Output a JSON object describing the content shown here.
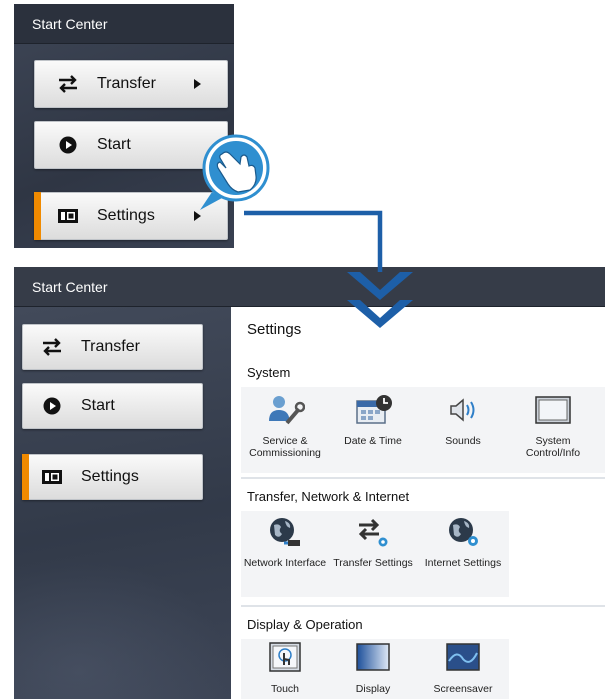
{
  "app_title": "Start Center",
  "top_menu": {
    "items": [
      {
        "label": "Transfer",
        "icon": "transfer-icon",
        "has_arrow": true
      },
      {
        "label": "Start",
        "icon": "play-icon",
        "has_arrow": false
      },
      {
        "label": "Settings",
        "icon": "settings-icon",
        "has_arrow": true,
        "active": true
      }
    ]
  },
  "sidebar": {
    "items": [
      {
        "label": "Transfer",
        "icon": "transfer-icon"
      },
      {
        "label": "Start",
        "icon": "play-icon"
      },
      {
        "label": "Settings",
        "icon": "settings-icon",
        "active": true
      }
    ]
  },
  "settings": {
    "title": "Settings",
    "sections": [
      {
        "title": "System",
        "items": [
          {
            "label": "Service & Commissioning",
            "icon": "service-commissioning-icon"
          },
          {
            "label": "Date & Time",
            "icon": "date-time-icon"
          },
          {
            "label": "Sounds",
            "icon": "speaker-icon"
          },
          {
            "label": "System Control/Info",
            "icon": "system-control-icon"
          }
        ]
      },
      {
        "title": "Transfer, Network & Internet",
        "items": [
          {
            "label": "Network Interface",
            "icon": "network-interface-icon"
          },
          {
            "label": "Transfer Settings",
            "icon": "transfer-settings-icon"
          },
          {
            "label": "Internet Settings",
            "icon": "internet-settings-icon"
          }
        ]
      },
      {
        "title": "Display & Operation",
        "items": [
          {
            "label": "Touch",
            "icon": "touch-icon"
          },
          {
            "label": "Display",
            "icon": "display-icon"
          },
          {
            "label": "Screensaver",
            "icon": "screensaver-icon"
          }
        ]
      }
    ]
  },
  "colors": {
    "accent": "#f08a00",
    "connector": "#1d5fa8",
    "titlebar": "#2b313d",
    "hand_badge": "#2f8fd0"
  }
}
